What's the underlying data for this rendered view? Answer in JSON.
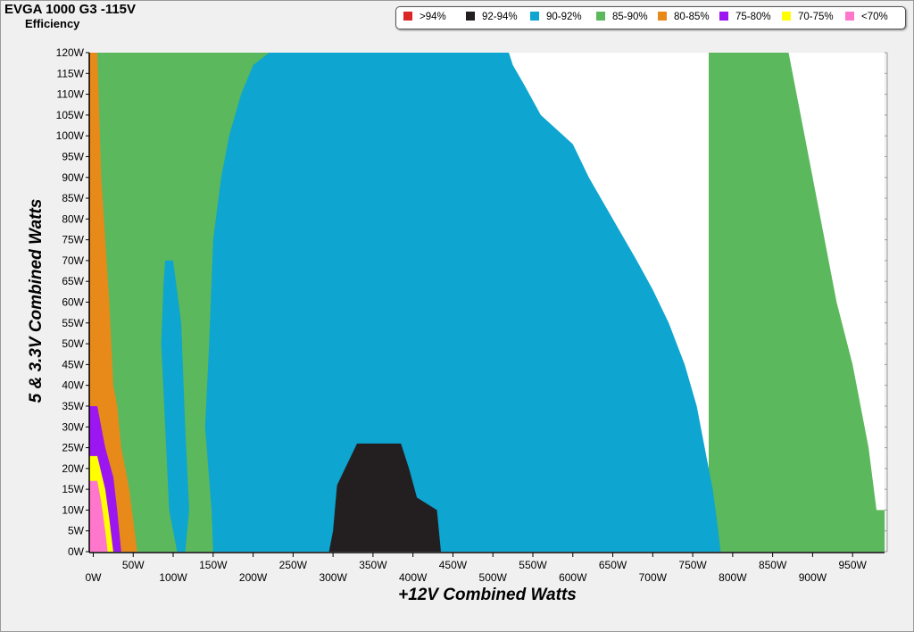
{
  "chart": {
    "title": "EVGA 1000 G3 -115V",
    "subtitle": "Efficiency"
  },
  "legend": [
    {
      "label": ">94%",
      "color": "#dc2626"
    },
    {
      "label": "92-94%",
      "color": "#231f20"
    },
    {
      "label": "90-92%",
      "color": "#0ea5d0"
    },
    {
      "label": "85-90%",
      "color": "#5cb85c"
    },
    {
      "label": "80-85%",
      "color": "#e88a1a"
    },
    {
      "label": "75-80%",
      "color": "#9b16f0"
    },
    {
      "label": "70-75%",
      "color": "#ffff00"
    },
    {
      "label": "<70%",
      "color": "#ff77cc"
    }
  ],
  "chart_data": {
    "type": "heatmap",
    "title": "EVGA 1000 G3 -115V",
    "subtitle": "Efficiency",
    "xlabel": "+12V Combined Watts",
    "ylabel": "5 & 3.3V Combined Watts",
    "x_unit": "W",
    "y_unit": "W",
    "xlim": [
      -5,
      990
    ],
    "ylim": [
      0,
      120
    ],
    "x_ticks": [
      "0W",
      "50W",
      "100W",
      "150W",
      "200W",
      "250W",
      "300W",
      "350W",
      "400W",
      "450W",
      "500W",
      "550W",
      "600W",
      "650W",
      "700W",
      "750W",
      "800W",
      "850W",
      "900W",
      "950W"
    ],
    "y_ticks": [
      "0W",
      "5W",
      "10W",
      "15W",
      "20W",
      "25W",
      "30W",
      "35W",
      "40W",
      "45W",
      "50W",
      "55W",
      "60W",
      "65W",
      "70W",
      "75W",
      "80W",
      "85W",
      "90W",
      "95W",
      "100W",
      "105W",
      "110W",
      "115W",
      "120W"
    ],
    "grid": false,
    "legend_position": "top-right",
    "regions": [
      {
        "class": "85-90%",
        "boundary": [
          [
            5,
            120
          ],
          [
            220,
            120
          ],
          [
            220,
            0
          ],
          [
            5,
            0
          ]
        ]
      },
      {
        "class": "85-90%",
        "boundary": [
          [
            520,
            120
          ],
          [
            870,
            120
          ],
          [
            890,
            100
          ],
          [
            910,
            80
          ],
          [
            930,
            60
          ],
          [
            950,
            45
          ],
          [
            970,
            25
          ],
          [
            980,
            10
          ],
          [
            990,
            10
          ],
          [
            990,
            0
          ],
          [
            770,
            0
          ],
          [
            770,
            120
          ]
        ]
      },
      {
        "class": "90-92%",
        "boundary": [
          [
            220,
            120
          ],
          [
            520,
            120
          ],
          [
            525,
            117
          ],
          [
            540,
            112
          ],
          [
            560,
            105
          ],
          [
            600,
            98
          ],
          [
            620,
            90
          ],
          [
            650,
            80
          ],
          [
            680,
            70
          ],
          [
            700,
            63
          ],
          [
            720,
            55
          ],
          [
            740,
            45
          ],
          [
            755,
            35
          ],
          [
            765,
            25
          ],
          [
            775,
            15
          ],
          [
            780,
            8
          ],
          [
            785,
            0
          ],
          [
            150,
            0
          ],
          [
            148,
            10
          ],
          [
            140,
            30
          ],
          [
            145,
            50
          ],
          [
            148,
            65
          ],
          [
            150,
            75
          ],
          [
            160,
            90
          ],
          [
            170,
            100
          ],
          [
            185,
            110
          ],
          [
            200,
            117
          ]
        ]
      },
      {
        "class": "90-92%",
        "boundary": [
          [
            90,
            70
          ],
          [
            100,
            70
          ],
          [
            110,
            55
          ],
          [
            115,
            30
          ],
          [
            120,
            10
          ],
          [
            115,
            0
          ],
          [
            105,
            0
          ],
          [
            95,
            10
          ],
          [
            90,
            30
          ],
          [
            85,
            50
          ],
          [
            88,
            65
          ]
        ]
      },
      {
        "class": "92-94%",
        "boundary": [
          [
            295,
            0
          ],
          [
            300,
            5
          ],
          [
            305,
            16
          ],
          [
            315,
            20
          ],
          [
            330,
            26
          ],
          [
            385,
            26
          ],
          [
            395,
            20
          ],
          [
            405,
            13
          ],
          [
            430,
            10
          ],
          [
            435,
            0
          ]
        ]
      },
      {
        "class": "80-85%",
        "boundary": [
          [
            -5,
            0
          ],
          [
            -5,
            120
          ],
          [
            5,
            120
          ],
          [
            10,
            90
          ],
          [
            20,
            60
          ],
          [
            25,
            40
          ],
          [
            30,
            35
          ],
          [
            35,
            25
          ],
          [
            45,
            15
          ],
          [
            55,
            0
          ]
        ]
      },
      {
        "class": "75-80%",
        "boundary": [
          [
            -5,
            0
          ],
          [
            -5,
            35
          ],
          [
            5,
            35
          ],
          [
            15,
            25
          ],
          [
            25,
            18
          ],
          [
            30,
            10
          ],
          [
            35,
            0
          ]
        ]
      },
      {
        "class": "70-75%",
        "boundary": [
          [
            -5,
            0
          ],
          [
            -5,
            23
          ],
          [
            5,
            23
          ],
          [
            15,
            15
          ],
          [
            20,
            8
          ],
          [
            25,
            0
          ]
        ]
      },
      {
        "class": "<70%",
        "boundary": [
          [
            -5,
            0
          ],
          [
            -5,
            17
          ],
          [
            5,
            17
          ],
          [
            10,
            12
          ],
          [
            15,
            5
          ],
          [
            18,
            0
          ]
        ]
      }
    ]
  }
}
